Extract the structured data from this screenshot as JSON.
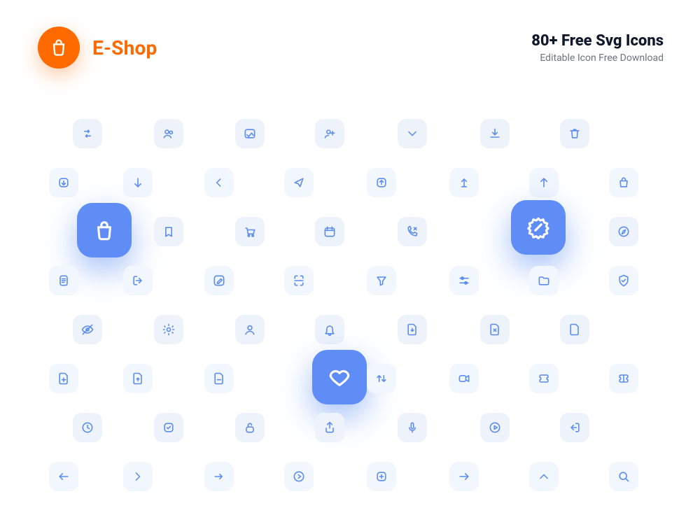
{
  "brand": {
    "title": "E-Shop"
  },
  "promo": {
    "title": "80+ Free Svg Icons",
    "subtitle": "Editable Icon Free Download"
  },
  "colors": {
    "accent": "#ff6a00",
    "icon_blue": "#5a8cf0",
    "tile_bg": "#eef3fb",
    "highlight_tile": "#5f8df5"
  },
  "highlighted": [
    "shopping-bag-icon",
    "discount-badge-icon",
    "heart-icon"
  ],
  "icons": {
    "row1": [
      "swap-icon",
      "group-icon",
      "gallery-icon",
      "user-plus-icon",
      "chevron-down-icon",
      "download-icon",
      "trash-icon"
    ],
    "row2": [
      "arrow-down-box-icon",
      "arrow-down-icon",
      "chevron-left-icon",
      "send-icon",
      "arrow-up-box-icon",
      "arrow-up-thin-icon",
      "arrow-up-icon",
      "bag-icon"
    ],
    "row3": [
      "shopping-bag-icon",
      "bookmark-icon",
      "cart-icon",
      "calendar-icon",
      "phone-missed-icon",
      "discount-badge-icon",
      "compass-icon"
    ],
    "row4": [
      "document-icon",
      "logout-icon",
      "edit-icon",
      "scan-icon",
      "filter-icon",
      "sliders-icon",
      "folder-icon",
      "shield-check-icon"
    ],
    "row5": [
      "eye-off-icon",
      "gear-icon",
      "user-icon",
      "bell-icon",
      "file-download-icon",
      "file-error-icon",
      "file-icon"
    ],
    "row6": [
      "file-plus-icon",
      "file-upload-icon",
      "file-minus-icon",
      "heart-icon",
      "sort-icon",
      "video-icon",
      "ticket-icon",
      "ticket-alt-icon"
    ],
    "row7": [
      "clock-icon",
      "checkbox-icon",
      "unlock-icon",
      "share-up-icon",
      "mic-icon",
      "play-circle-icon",
      "login-icon"
    ],
    "row8": [
      "arrow-left-icon",
      "chevron-right-icon",
      "arrow-right-thin-icon",
      "next-circle-icon",
      "exit-icon",
      "arrow-right-icon",
      "chevron-up-icon",
      "search-icon"
    ]
  }
}
